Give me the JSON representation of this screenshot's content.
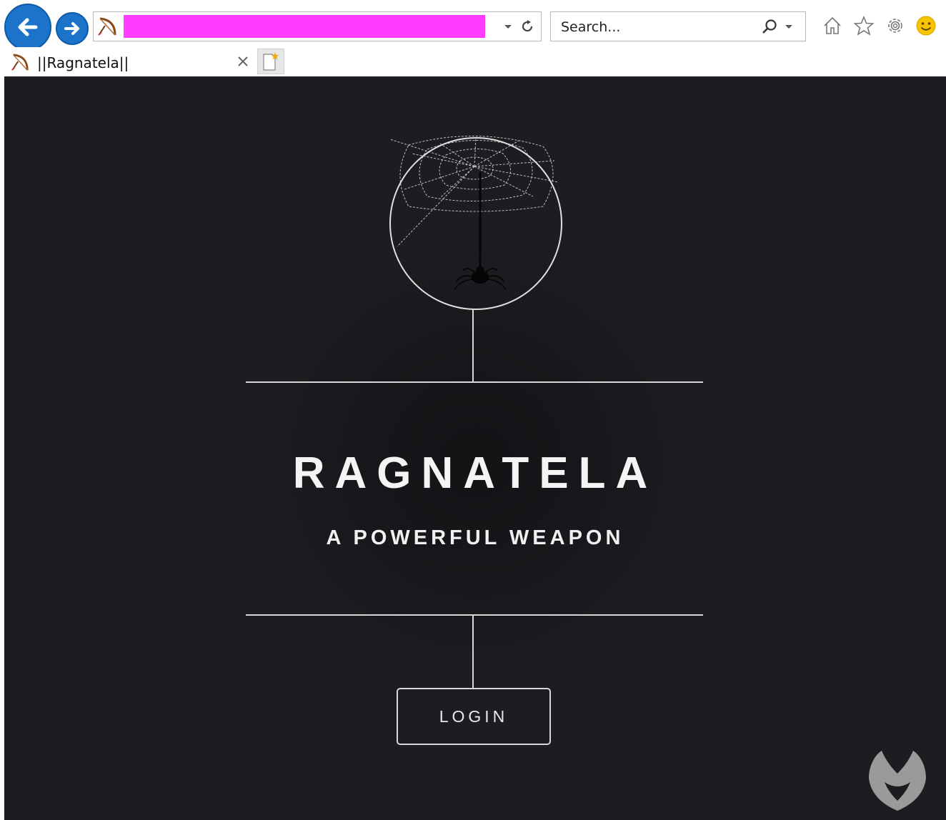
{
  "browser": {
    "url": "",
    "search_placeholder": "Search...",
    "tab_title": "||Ragnatela||"
  },
  "page": {
    "title": "RAGNATELA",
    "subtitle": "A POWERFUL WEAPON",
    "login_label": "LOGIN"
  },
  "icons": {
    "back": "back-arrow-icon",
    "forward": "forward-arrow-icon",
    "site": "bow-favicon-icon",
    "home": "home-icon",
    "favorites": "star-icon",
    "settings": "gear-icon",
    "feedback": "smiley-icon",
    "watermark": "malwarebytes-logo"
  },
  "colors": {
    "page_background": "#1b1d20",
    "accent_blue": "#1b74c9",
    "redaction": "#ff3cff",
    "line": "#d8d8d8"
  }
}
